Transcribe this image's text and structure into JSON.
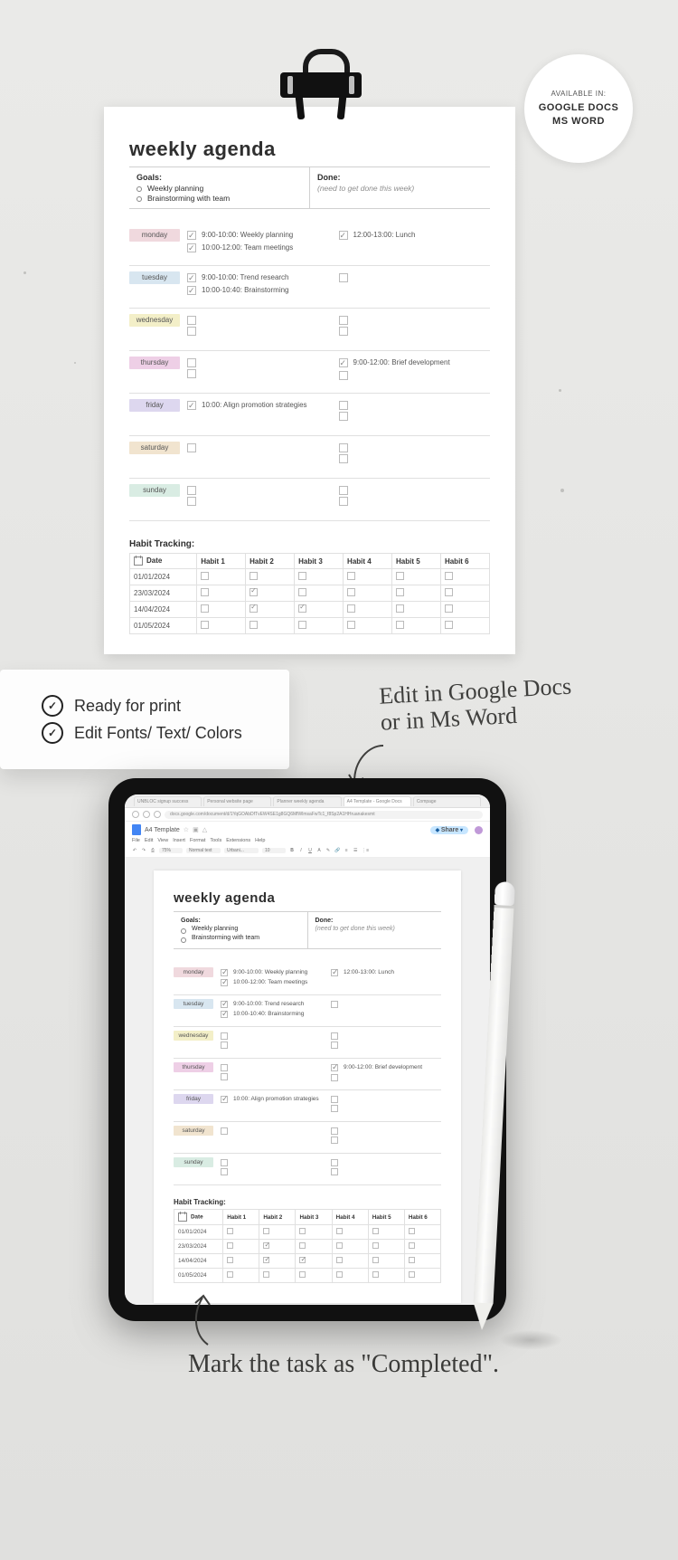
{
  "badge": {
    "heading": "AVAILABLE IN:",
    "line1": "GOOGLE DOCS",
    "line2": "MS WORD"
  },
  "features": {
    "a": "Ready for print",
    "b": "Edit Fonts/ Text/ Colors"
  },
  "hand": {
    "edit": "Edit in Google Docs or in Ms Word",
    "mark": "Mark the task as \"Completed\"."
  },
  "doc": {
    "title": "weekly agenda",
    "goals_label": "Goals:",
    "goals": [
      "Weekly planning",
      "Brainstorming with team"
    ],
    "done_label": "Done:",
    "done_note": "(need to get done this week)",
    "days_labels": {
      "mon": "monday",
      "tue": "tuesday",
      "wed": "wednesday",
      "thu": "thursday",
      "fri": "friday",
      "sat": "saturday",
      "sun": "sunday"
    },
    "tasks": {
      "mon": {
        "l": [
          {
            "t": "9:00-10:00: Weekly planning",
            "d": true
          },
          {
            "t": "10:00-12:00: Team meetings",
            "d": true
          }
        ],
        "r": [
          {
            "t": "12:00-13:00: Lunch",
            "d": true
          }
        ]
      },
      "tue": {
        "l": [
          {
            "t": "9:00-10:00: Trend research",
            "d": true
          },
          {
            "t": "10:00-10:40: Brainstorming",
            "d": true
          }
        ],
        "r": [
          {
            "t": "",
            "d": false
          }
        ]
      },
      "wed": {
        "l": [
          {
            "t": "",
            "d": false
          },
          {
            "t": "",
            "d": false
          }
        ],
        "r": [
          {
            "t": "",
            "d": false
          },
          {
            "t": "",
            "d": false
          }
        ]
      },
      "thu": {
        "l": [
          {
            "t": "",
            "d": false
          },
          {
            "t": "",
            "d": false
          }
        ],
        "r": [
          {
            "t": "9:00-12:00: Brief development",
            "d": true
          },
          {
            "t": "",
            "d": false
          }
        ]
      },
      "fri": {
        "l": [
          {
            "t": "10:00: Align promotion strategies",
            "d": true
          }
        ],
        "r": [
          {
            "t": "",
            "d": false
          },
          {
            "t": "",
            "d": false
          }
        ]
      },
      "sat": {
        "l": [
          {
            "t": "",
            "d": false
          }
        ],
        "r": [
          {
            "t": "",
            "d": false
          },
          {
            "t": "",
            "d": false
          }
        ]
      },
      "sun": {
        "l": [
          {
            "t": "",
            "d": false
          },
          {
            "t": "",
            "d": false
          }
        ],
        "r": [
          {
            "t": "",
            "d": false
          },
          {
            "t": "",
            "d": false
          }
        ]
      }
    },
    "habit_heading": "Habit Tracking:",
    "habit_cols": [
      "Date",
      "Habit 1",
      "Habit 2",
      "Habit 3",
      "Habit 4",
      "Habit 5",
      "Habit 6"
    ],
    "habit_rows": [
      {
        "date": "01/01/2024",
        "c": [
          0,
          0,
          0,
          0,
          0,
          0
        ]
      },
      {
        "date": "23/03/2024",
        "c": [
          0,
          1,
          0,
          0,
          0,
          0
        ]
      },
      {
        "date": "14/04/2024",
        "c": [
          0,
          1,
          1,
          0,
          0,
          0
        ]
      },
      {
        "date": "01/05/2024",
        "c": [
          0,
          0,
          0,
          0,
          0,
          0
        ]
      }
    ]
  },
  "gdocs": {
    "tabs": [
      "UNBLOC signup success",
      "Personal website page",
      "Planner weekly agenda",
      "A4 Template - Google Docs",
      "Compage"
    ],
    "url": "docs.google.com/document/d/1YqGOAbDfTvEW4SE1g8GQ6MfWlmsaFwTc1_f8Sp2A1HHruanakesmt",
    "doc_name": "A4 Template",
    "star": "☆",
    "folder": "▣",
    "cloud": "△",
    "share_btn": "Share",
    "menu": [
      "File",
      "Edit",
      "View",
      "Insert",
      "Format",
      "Tools",
      "Extensions",
      "Help"
    ],
    "toolbar": {
      "undo": "↶",
      "redo": "↷",
      "print": "⎙",
      "zoom": "75%",
      "style": "Normal text",
      "font": "Urbani...",
      "size": "10"
    }
  }
}
